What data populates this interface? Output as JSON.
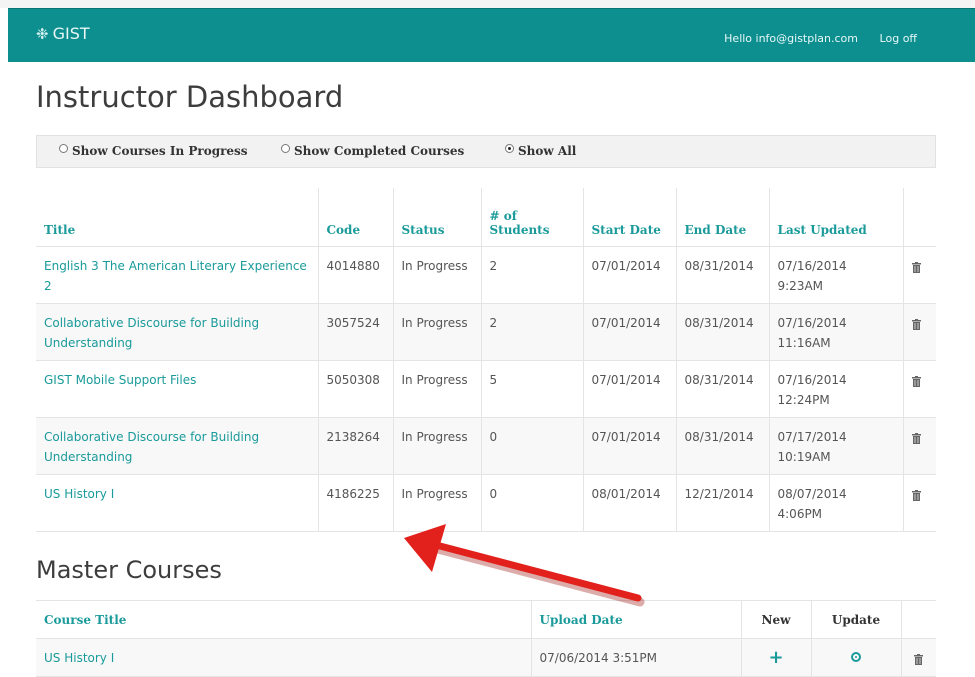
{
  "header": {
    "logo_text": "GIST",
    "greeting": "Hello info@gistplan.com",
    "logoff_label": "Log off",
    "bg_color": "#0e8f8f"
  },
  "page_title": "Instructor Dashboard",
  "filters": [
    {
      "label": "Show Courses In Progress",
      "selected": false
    },
    {
      "label": "Show Completed Courses",
      "selected": false
    },
    {
      "label": "Show All",
      "selected": true
    }
  ],
  "courses_table": {
    "headers": [
      "Title",
      "Code",
      "Status",
      "# of Students",
      "Start Date",
      "End Date",
      "Last Updated",
      ""
    ],
    "rows": [
      {
        "title": "English 3 The American Literary Experience 2",
        "code": "4014880",
        "status": "In Progress",
        "students": "2",
        "start": "07/01/2014",
        "end": "08/31/2014",
        "updated": "07/16/2014 9:23AM"
      },
      {
        "title": "Collaborative Discourse for Building Understanding",
        "code": "3057524",
        "status": "In Progress",
        "students": "2",
        "start": "07/01/2014",
        "end": "08/31/2014",
        "updated": "07/16/2014 11:16AM"
      },
      {
        "title": "GIST Mobile Support Files",
        "code": "5050308",
        "status": "In Progress",
        "students": "5",
        "start": "07/01/2014",
        "end": "08/31/2014",
        "updated": "07/16/2014 12:24PM"
      },
      {
        "title": "Collaborative Discourse for Building Understanding",
        "code": "2138264",
        "status": "In Progress",
        "students": "0",
        "start": "07/01/2014",
        "end": "08/31/2014",
        "updated": "07/17/2014 10:19AM"
      },
      {
        "title": "US History I",
        "code": "4186225",
        "status": "In Progress",
        "students": "0",
        "start": "08/01/2014",
        "end": "12/21/2014",
        "updated": "08/07/2014 4:06PM"
      }
    ]
  },
  "master_title": "Master Courses",
  "master_table": {
    "headers": [
      "Course Title",
      "Upload Date",
      "New",
      "Update",
      ""
    ],
    "rows": [
      {
        "title": "US History I",
        "upload": "07/06/2014 3:51PM"
      }
    ]
  },
  "colors": {
    "accent": "#1a9a9a",
    "annotation_arrow": "#e3211c"
  },
  "icons": {
    "delete": "trash-icon",
    "new": "plus-icon",
    "update": "circle-dot-icon",
    "logo": "gist-logo-icon"
  }
}
